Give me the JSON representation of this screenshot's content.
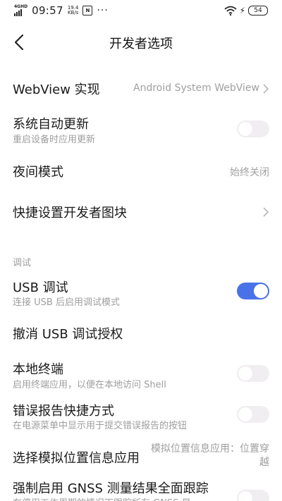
{
  "status_bar": {
    "network": "4GHD",
    "time": "09:57",
    "speed_value": "19.4",
    "speed_unit": "KB/s",
    "nfc": "N",
    "dots": "···",
    "battery": "54"
  },
  "header": {
    "title": "开发者选项",
    "back_icon": "chevron-left-icon"
  },
  "settings": {
    "webview": {
      "label": "WebView 实现",
      "value": "Android System WebView"
    },
    "auto_update": {
      "label": "系统自动更新",
      "sub": "重启设备时应用更新",
      "on": false
    },
    "night_mode": {
      "label": "夜间模式",
      "value": "始终关闭"
    },
    "quick_tiles": {
      "label": "快捷设置开发者图块"
    },
    "debug_section": "调试",
    "usb_debug": {
      "label": "USB 调试",
      "sub": "连接 USB 后启用调试模式",
      "on": true
    },
    "revoke_usb": {
      "label": "撤消 USB 调试授权"
    },
    "local_terminal": {
      "label": "本地终端",
      "sub": "启用终端应用，以便在本地访问 Shell",
      "on": false
    },
    "bug_report": {
      "label": "错误报告快捷方式",
      "sub": "在电源菜单中显示用于提交错误报告的按钮",
      "on": false
    },
    "mock_location": {
      "label": "选择模拟位置信息应用",
      "value": "模拟位置信息应用：位置穿越"
    },
    "gnss": {
      "label": "强制启用 GNSS 测量结果全面跟踪",
      "sub": "在停用工作周期的情况下跟踪所有 GNSS 星"
    }
  },
  "colors": {
    "accent": "#4a72e8",
    "toggle_off": "#f1eef1",
    "secondary_text": "#9e9e9e"
  }
}
